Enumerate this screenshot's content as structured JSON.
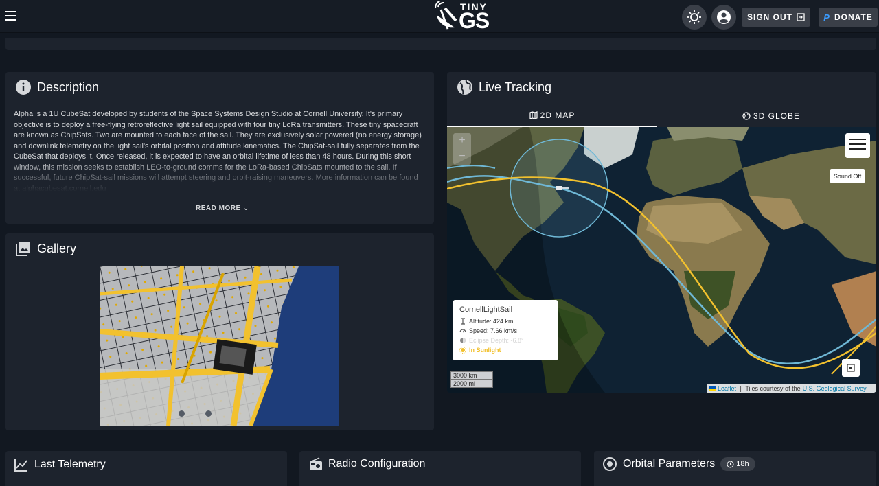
{
  "header": {
    "logo_small": "TINY",
    "logo_big": "GS",
    "sign_out_label": "SIGN OUT",
    "donate_label": "DONATE"
  },
  "description": {
    "title": "Description",
    "text": "Alpha is a 1U CubeSat developed by students of the Space Systems Design Studio at Cornell University. It's primary objective is to deploy a free-flying retroreflective light sail equipped with four tiny LoRa transmitters. These tiny spacecraft are known as ChipSats. Two are mounted to each face of the sail. They are exclusively solar powered (no energy storage) and downlink telemetry on the light sail's orbital position and attitude kinematics. The ChipSat-sail fully separates from the CubeSat that deploys it. Once released, it is expected to have an orbital lifetime of less than 48 hours. During this short window, this mission seeks to establish LEO-to-ground comms for the LoRa-based ChipSats mounted to the sail. If successful, future ChipSat-sail missions will attempt steering and orbit-raising maneuvers. More information can be found at alphacubesat.cornell.edu",
    "read_more": "READ MORE"
  },
  "gallery": {
    "title": "Gallery"
  },
  "live_tracking": {
    "title": "Live Tracking",
    "tabs": [
      {
        "label": "2D MAP",
        "active": true
      },
      {
        "label": "3D GLOBE",
        "active": false
      }
    ],
    "satellite": {
      "name": "CornellLightSail",
      "altitude": "Altitude: 424 km",
      "speed": "Speed: 7.66 km/s",
      "eclipse": "Eclipse Depth: -6.8°",
      "sunlight": "In Sunlight"
    },
    "sound_label": "Sound Off",
    "zoom_in": "+",
    "zoom_out": "−",
    "scale_km": "3000 km",
    "scale_mi": "2000 mi",
    "attribution_leaflet": "Leaflet",
    "attribution_text": "Tiles courtesy of the",
    "attribution_link": "U.S. Geological Survey"
  },
  "bottom": {
    "telemetry_title": "Last Telemetry",
    "radio_title": "Radio Configuration",
    "orbital_title": "Orbital Parameters",
    "orbital_badge": "18h"
  },
  "colors": {
    "accent_yellow": "#f2c12e",
    "track_blue": "#6fb8d6",
    "card_bg": "#1d232d",
    "page_bg": "#121821"
  }
}
